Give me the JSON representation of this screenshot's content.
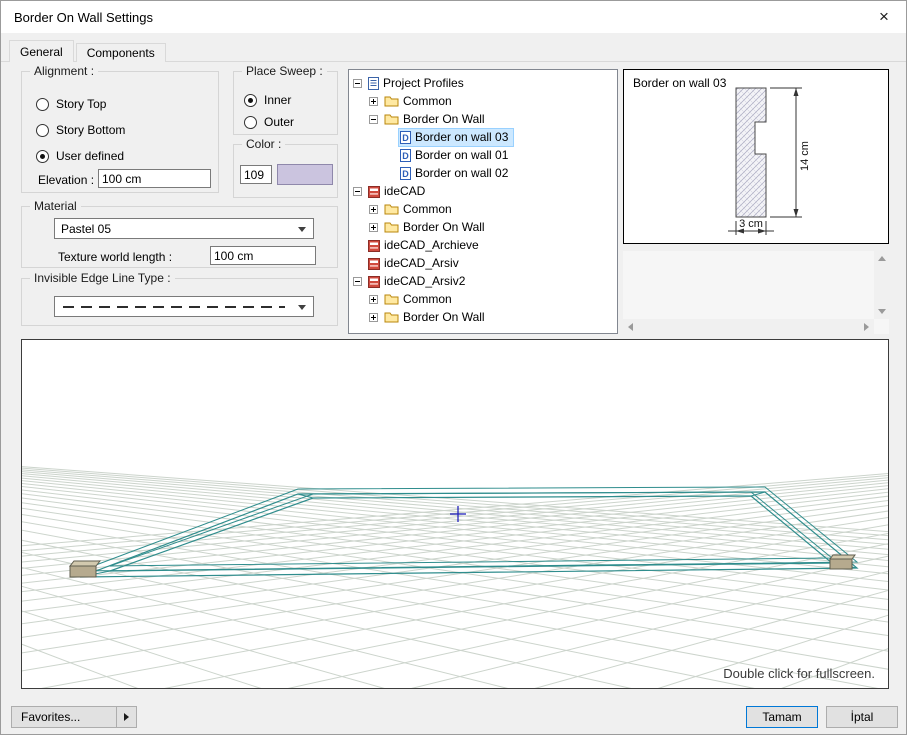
{
  "window": {
    "title": "Border On Wall Settings",
    "close_icon": "×"
  },
  "tabs": [
    {
      "label": "General",
      "active": true
    },
    {
      "label": "Components",
      "active": false
    }
  ],
  "alignment": {
    "legend": "Alignment :",
    "options": [
      {
        "label": "Story Top",
        "selected": false
      },
      {
        "label": "Story Bottom",
        "selected": false
      },
      {
        "label": "User defined",
        "selected": true
      }
    ],
    "elevation_label": "Elevation :",
    "elevation_value": "100 cm"
  },
  "place_sweep": {
    "legend": "Place Sweep :",
    "options": [
      {
        "label": "Inner",
        "selected": true
      },
      {
        "label": "Outer",
        "selected": false
      }
    ]
  },
  "color": {
    "legend": "Color :",
    "index_value": "109",
    "swatch_hex": "#cbc4df"
  },
  "material": {
    "legend": "Material",
    "selected_value": "Pastel 05",
    "texture_label": "Texture world length :",
    "texture_value": "100 cm"
  },
  "invisible_edge": {
    "legend": "Invisible Edge Line Type :"
  },
  "profile_tree": {
    "items": [
      {
        "depth": 0,
        "expander": "minus",
        "icon": "document",
        "label": "Project Profiles",
        "selected": false
      },
      {
        "depth": 1,
        "expander": "plus",
        "icon": "folder",
        "label": "Common",
        "selected": false
      },
      {
        "depth": 1,
        "expander": "minus",
        "icon": "folder",
        "label": "Border On Wall",
        "selected": false
      },
      {
        "depth": 2,
        "expander": "none",
        "icon": "profile",
        "label": "Border on wall 03",
        "selected": true
      },
      {
        "depth": 2,
        "expander": "none",
        "icon": "profile",
        "label": "Border on wall 01",
        "selected": false
      },
      {
        "depth": 2,
        "expander": "none",
        "icon": "profile",
        "label": "Border on wall 02",
        "selected": false
      },
      {
        "depth": 0,
        "expander": "minus",
        "icon": "library",
        "label": "ideCAD",
        "selected": false
      },
      {
        "depth": 1,
        "expander": "plus",
        "icon": "folder",
        "label": "Common",
        "selected": false
      },
      {
        "depth": 1,
        "expander": "plus",
        "icon": "folder",
        "label": "Border On Wall",
        "selected": false
      },
      {
        "depth": 0,
        "expander": "none",
        "icon": "library",
        "label": "ideCAD_Archieve",
        "selected": false
      },
      {
        "depth": 0,
        "expander": "none",
        "icon": "library",
        "label": "ideCAD_Arsiv",
        "selected": false
      },
      {
        "depth": 0,
        "expander": "minus",
        "icon": "library",
        "label": "ideCAD_Arsiv2",
        "selected": false
      },
      {
        "depth": 1,
        "expander": "plus",
        "icon": "folder",
        "label": "Common",
        "selected": false
      },
      {
        "depth": 1,
        "expander": "plus",
        "icon": "folder",
        "label": "Border On Wall",
        "selected": false
      }
    ]
  },
  "preview": {
    "title": "Border on wall 03",
    "height_dim": "14 cm",
    "width_dim": "3 cm"
  },
  "viewport": {
    "hint": "Double click for fullscreen.",
    "sweep_color": "#2f8d8d"
  },
  "footer": {
    "favorites_label": "Favorites...",
    "ok_label": "Tamam",
    "cancel_label": "İptal"
  }
}
